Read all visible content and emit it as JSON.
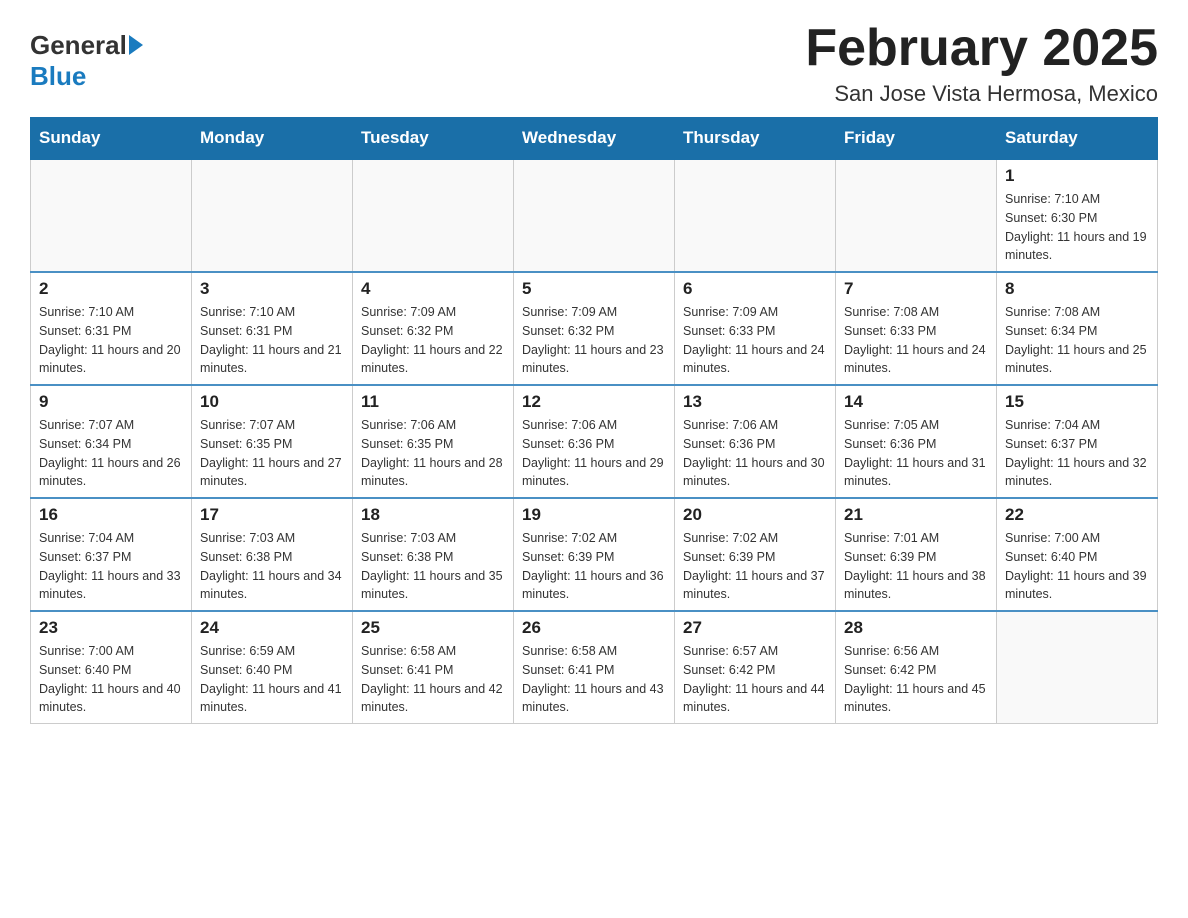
{
  "header": {
    "title": "February 2025",
    "subtitle": "San Jose Vista Hermosa, Mexico",
    "logo_general": "General",
    "logo_blue": "Blue"
  },
  "days_of_week": [
    "Sunday",
    "Monday",
    "Tuesday",
    "Wednesday",
    "Thursday",
    "Friday",
    "Saturday"
  ],
  "weeks": [
    [
      {
        "day": "",
        "info": ""
      },
      {
        "day": "",
        "info": ""
      },
      {
        "day": "",
        "info": ""
      },
      {
        "day": "",
        "info": ""
      },
      {
        "day": "",
        "info": ""
      },
      {
        "day": "",
        "info": ""
      },
      {
        "day": "1",
        "info": "Sunrise: 7:10 AM\nSunset: 6:30 PM\nDaylight: 11 hours and 19 minutes."
      }
    ],
    [
      {
        "day": "2",
        "info": "Sunrise: 7:10 AM\nSunset: 6:31 PM\nDaylight: 11 hours and 20 minutes."
      },
      {
        "day": "3",
        "info": "Sunrise: 7:10 AM\nSunset: 6:31 PM\nDaylight: 11 hours and 21 minutes."
      },
      {
        "day": "4",
        "info": "Sunrise: 7:09 AM\nSunset: 6:32 PM\nDaylight: 11 hours and 22 minutes."
      },
      {
        "day": "5",
        "info": "Sunrise: 7:09 AM\nSunset: 6:32 PM\nDaylight: 11 hours and 23 minutes."
      },
      {
        "day": "6",
        "info": "Sunrise: 7:09 AM\nSunset: 6:33 PM\nDaylight: 11 hours and 24 minutes."
      },
      {
        "day": "7",
        "info": "Sunrise: 7:08 AM\nSunset: 6:33 PM\nDaylight: 11 hours and 24 minutes."
      },
      {
        "day": "8",
        "info": "Sunrise: 7:08 AM\nSunset: 6:34 PM\nDaylight: 11 hours and 25 minutes."
      }
    ],
    [
      {
        "day": "9",
        "info": "Sunrise: 7:07 AM\nSunset: 6:34 PM\nDaylight: 11 hours and 26 minutes."
      },
      {
        "day": "10",
        "info": "Sunrise: 7:07 AM\nSunset: 6:35 PM\nDaylight: 11 hours and 27 minutes."
      },
      {
        "day": "11",
        "info": "Sunrise: 7:06 AM\nSunset: 6:35 PM\nDaylight: 11 hours and 28 minutes."
      },
      {
        "day": "12",
        "info": "Sunrise: 7:06 AM\nSunset: 6:36 PM\nDaylight: 11 hours and 29 minutes."
      },
      {
        "day": "13",
        "info": "Sunrise: 7:06 AM\nSunset: 6:36 PM\nDaylight: 11 hours and 30 minutes."
      },
      {
        "day": "14",
        "info": "Sunrise: 7:05 AM\nSunset: 6:36 PM\nDaylight: 11 hours and 31 minutes."
      },
      {
        "day": "15",
        "info": "Sunrise: 7:04 AM\nSunset: 6:37 PM\nDaylight: 11 hours and 32 minutes."
      }
    ],
    [
      {
        "day": "16",
        "info": "Sunrise: 7:04 AM\nSunset: 6:37 PM\nDaylight: 11 hours and 33 minutes."
      },
      {
        "day": "17",
        "info": "Sunrise: 7:03 AM\nSunset: 6:38 PM\nDaylight: 11 hours and 34 minutes."
      },
      {
        "day": "18",
        "info": "Sunrise: 7:03 AM\nSunset: 6:38 PM\nDaylight: 11 hours and 35 minutes."
      },
      {
        "day": "19",
        "info": "Sunrise: 7:02 AM\nSunset: 6:39 PM\nDaylight: 11 hours and 36 minutes."
      },
      {
        "day": "20",
        "info": "Sunrise: 7:02 AM\nSunset: 6:39 PM\nDaylight: 11 hours and 37 minutes."
      },
      {
        "day": "21",
        "info": "Sunrise: 7:01 AM\nSunset: 6:39 PM\nDaylight: 11 hours and 38 minutes."
      },
      {
        "day": "22",
        "info": "Sunrise: 7:00 AM\nSunset: 6:40 PM\nDaylight: 11 hours and 39 minutes."
      }
    ],
    [
      {
        "day": "23",
        "info": "Sunrise: 7:00 AM\nSunset: 6:40 PM\nDaylight: 11 hours and 40 minutes."
      },
      {
        "day": "24",
        "info": "Sunrise: 6:59 AM\nSunset: 6:40 PM\nDaylight: 11 hours and 41 minutes."
      },
      {
        "day": "25",
        "info": "Sunrise: 6:58 AM\nSunset: 6:41 PM\nDaylight: 11 hours and 42 minutes."
      },
      {
        "day": "26",
        "info": "Sunrise: 6:58 AM\nSunset: 6:41 PM\nDaylight: 11 hours and 43 minutes."
      },
      {
        "day": "27",
        "info": "Sunrise: 6:57 AM\nSunset: 6:42 PM\nDaylight: 11 hours and 44 minutes."
      },
      {
        "day": "28",
        "info": "Sunrise: 6:56 AM\nSunset: 6:42 PM\nDaylight: 11 hours and 45 minutes."
      },
      {
        "day": "",
        "info": ""
      }
    ]
  ]
}
